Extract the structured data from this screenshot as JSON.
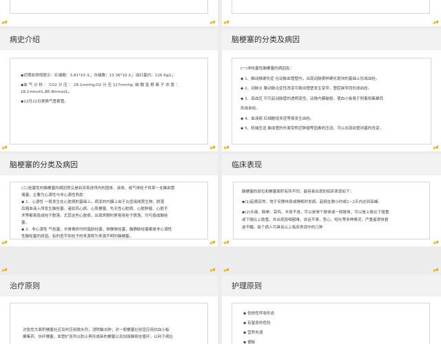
{
  "slides": {
    "s1": {
      "title": "病史介绍",
      "lines": [
        "◆近期血常规提示：红细胞：3.81*10  /L；白细胞：13.36*10  /L；血红蛋白：126.6g/L；",
        "◆血 气 分 析 ： CO2 分 压 ： 28.1mmhg;O2 分 压 127mmhg; 碳 酸 氢 根 离 子 浓 度 ：",
        "18.1mmol/L,BE-8mmol/L。",
        "◆12月22日更换气管套管。"
      ]
    },
    "s2": {
      "title": "脑梗塞的分类及病因",
      "lines": [
        "(一)非栓塞性脑梗塞的病因有：",
        "◆  1、脑动脉硬化症    在动脉血管壁内，出现动脉粥样硬化斑块的基础上形成血栓。",
        "◆  2、动脉炎    脑动脉炎症性改变可致血管壁发生变窄，管腔狭窄而形成血栓。",
        "◆  3、高血压    可引起动脉壁的透明变性，动脉内膜破裂，使血小板易于附着和集聚而",
        "形成血栓。",
        "◆  4、血液病    红细胞增多症等易发生血栓。",
        "◆  5、机械压迫    脑血管的外面受附近肿瘤等因素的压迫，可以出现血管闭塞的改变。"
      ]
    },
    "s3": {
      "title": "脑梗塞的分类及病因",
      "lines": [
        "(二)栓塞性的脑梗塞的病因常见是血流带进颅内的固体、液体、或气体栓子将某一支脑血管",
        "堵塞。主要为心源性与非心源性两类：",
        "◆  1．心源性    一般发生在心脏病的基础上。病变的内膜上由于炎症组成赘生物，脱落",
        "后随血液入颅发生脑栓塞。诸如风心病、心肌梗塞、先天性心脏病、心脏肿瘤、心脏手",
        "术等都易造成栓子脱落。尤其这些心脏病，出现房颤时更易将栓子脱落，均可造成脑栓",
        "塞。",
        "◆ 2．非心源性    气栓塞，长骨骨折时的脂肪栓塞，肺静脉栓塞，脑静脉栓塞都是非心源性",
        "性脑栓塞的原因。有的查不到栓子的来源称为来源不明的脑梗塞。"
      ]
    },
    "s4": {
      "title": "临床表现",
      "lines": [
        "脑梗塞的部位和梗塞面积有所不同，最容易出现的临床表现如下：",
        "◆(1)起病突然，常于安静休息或睡眠时发病。起病在数小时或1~2天内达到高峰。",
        "◆(2)头痛、眩晕、耳鸣、半身不遂，可以是单个肢体或一侧肢体，可以是上肢比下肢重",
        "或下肢比上肢重，并出现吞咽困难，说话不清，恶心、呕吐等多种情况，严重者很快昏",
        "迷不醒。每个病人可具有以上临床表现中的几种"
      ]
    },
    "s5": {
      "title": "治疗原则",
      "lines": [
        "对急性大面积梗塞社应及时应用脱水剂，消除脑水肿；对一般梗塞社则宜应用抗血小板",
        "聚集药、抗纤梗塞，血管扩张剂以防止再形成新的梗塞以及加强脑侧支循环，以利于病灶"
      ]
    },
    "s6": {
      "title": "护理原则",
      "items": [
        "◆  低效性呼吸形态",
        "◆  有窒息的危险",
        "◆  营养失调",
        "◆  便秘"
      ]
    }
  }
}
